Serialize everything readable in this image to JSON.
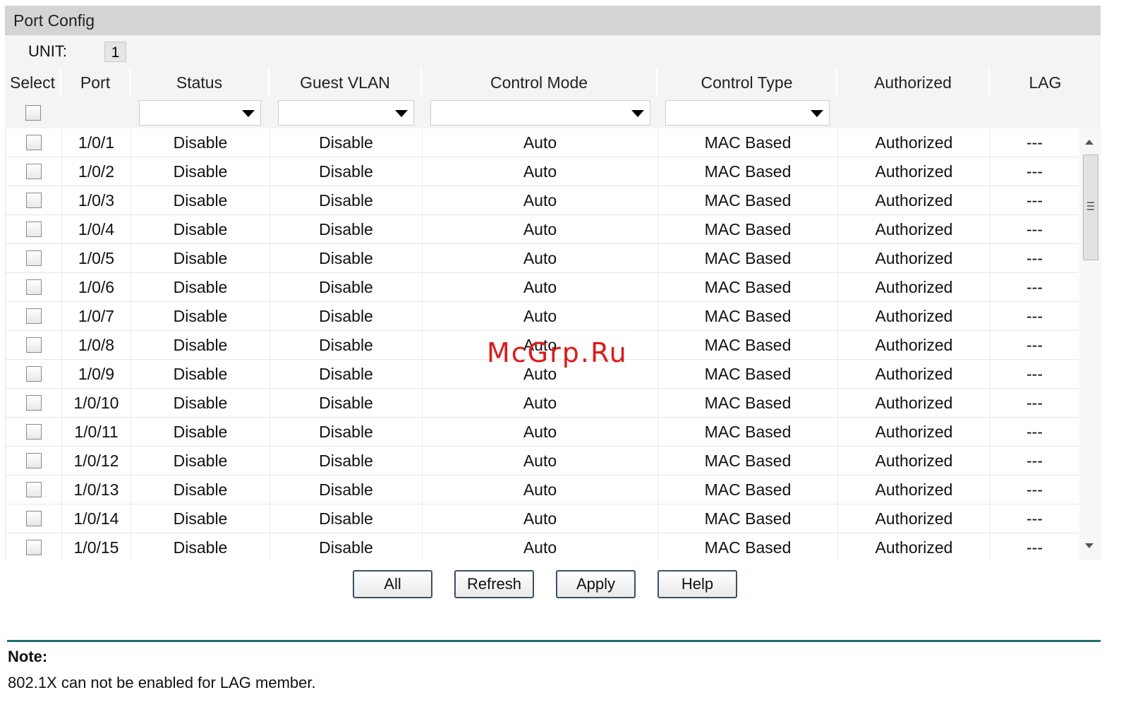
{
  "panel": {
    "title": "Port Config"
  },
  "unit": {
    "label": "UNIT:",
    "value": "1"
  },
  "columns": [
    "Select",
    "Port",
    "Status",
    "Guest VLAN",
    "Control Mode",
    "Control Type",
    "Authorized",
    "LAG"
  ],
  "rows": [
    {
      "port": "1/0/1",
      "status": "Disable",
      "guest_vlan": "Disable",
      "control_mode": "Auto",
      "control_type": "MAC Based",
      "authorized": "Authorized",
      "lag": "---"
    },
    {
      "port": "1/0/2",
      "status": "Disable",
      "guest_vlan": "Disable",
      "control_mode": "Auto",
      "control_type": "MAC Based",
      "authorized": "Authorized",
      "lag": "---"
    },
    {
      "port": "1/0/3",
      "status": "Disable",
      "guest_vlan": "Disable",
      "control_mode": "Auto",
      "control_type": "MAC Based",
      "authorized": "Authorized",
      "lag": "---"
    },
    {
      "port": "1/0/4",
      "status": "Disable",
      "guest_vlan": "Disable",
      "control_mode": "Auto",
      "control_type": "MAC Based",
      "authorized": "Authorized",
      "lag": "---"
    },
    {
      "port": "1/0/5",
      "status": "Disable",
      "guest_vlan": "Disable",
      "control_mode": "Auto",
      "control_type": "MAC Based",
      "authorized": "Authorized",
      "lag": "---"
    },
    {
      "port": "1/0/6",
      "status": "Disable",
      "guest_vlan": "Disable",
      "control_mode": "Auto",
      "control_type": "MAC Based",
      "authorized": "Authorized",
      "lag": "---"
    },
    {
      "port": "1/0/7",
      "status": "Disable",
      "guest_vlan": "Disable",
      "control_mode": "Auto",
      "control_type": "MAC Based",
      "authorized": "Authorized",
      "lag": "---"
    },
    {
      "port": "1/0/8",
      "status": "Disable",
      "guest_vlan": "Disable",
      "control_mode": "Auto",
      "control_type": "MAC Based",
      "authorized": "Authorized",
      "lag": "---"
    },
    {
      "port": "1/0/9",
      "status": "Disable",
      "guest_vlan": "Disable",
      "control_mode": "Auto",
      "control_type": "MAC Based",
      "authorized": "Authorized",
      "lag": "---"
    },
    {
      "port": "1/0/10",
      "status": "Disable",
      "guest_vlan": "Disable",
      "control_mode": "Auto",
      "control_type": "MAC Based",
      "authorized": "Authorized",
      "lag": "---"
    },
    {
      "port": "1/0/11",
      "status": "Disable",
      "guest_vlan": "Disable",
      "control_mode": "Auto",
      "control_type": "MAC Based",
      "authorized": "Authorized",
      "lag": "---"
    },
    {
      "port": "1/0/12",
      "status": "Disable",
      "guest_vlan": "Disable",
      "control_mode": "Auto",
      "control_type": "MAC Based",
      "authorized": "Authorized",
      "lag": "---"
    },
    {
      "port": "1/0/13",
      "status": "Disable",
      "guest_vlan": "Disable",
      "control_mode": "Auto",
      "control_type": "MAC Based",
      "authorized": "Authorized",
      "lag": "---"
    },
    {
      "port": "1/0/14",
      "status": "Disable",
      "guest_vlan": "Disable",
      "control_mode": "Auto",
      "control_type": "MAC Based",
      "authorized": "Authorized",
      "lag": "---"
    },
    {
      "port": "1/0/15",
      "status": "Disable",
      "guest_vlan": "Disable",
      "control_mode": "Auto",
      "control_type": "MAC Based",
      "authorized": "Authorized",
      "lag": "---"
    }
  ],
  "buttons": {
    "all": "All",
    "refresh": "Refresh",
    "apply": "Apply",
    "help": "Help"
  },
  "note": {
    "title": "Note:",
    "text": "802.1X can not be enabled for LAG member."
  },
  "watermark": "McGrp.Ru",
  "colors": {
    "header_bg": "#d4d4d4",
    "row_bg": "#f4f4f4",
    "divider": "#1f6d73",
    "button_border": "#3e4f66",
    "watermark": "#dd1a1a"
  },
  "icons": {
    "dropdown": "triangle-down-icon",
    "scroll_up": "arrow-up-icon",
    "scroll_down": "arrow-down-icon"
  }
}
